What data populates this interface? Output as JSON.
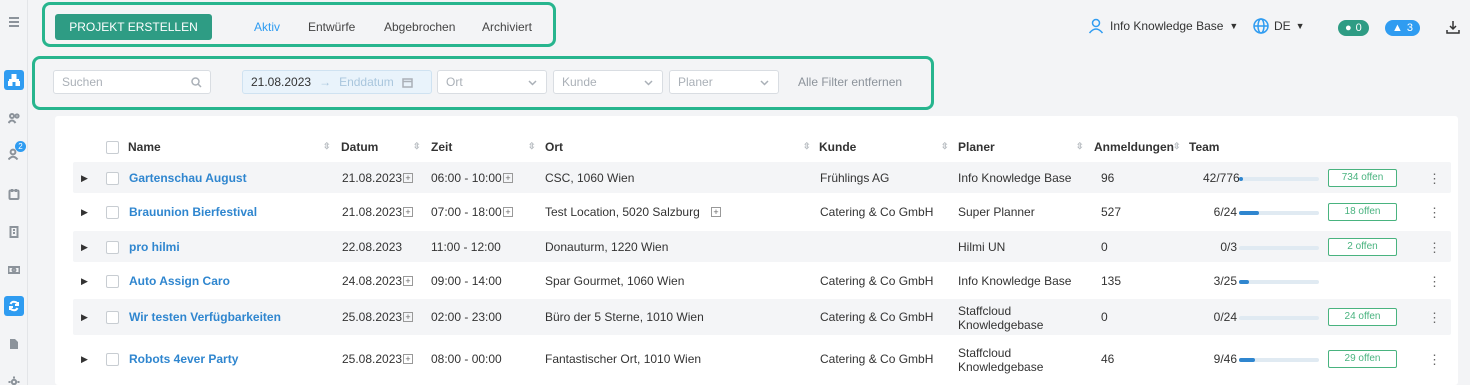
{
  "toolbar": {
    "create_label": "PROJEKT ERSTELLEN",
    "tabs": [
      {
        "label": "Aktiv"
      },
      {
        "label": "Entwürfe"
      },
      {
        "label": "Abgebrochen"
      },
      {
        "label": "Archiviert"
      }
    ],
    "user_label": "Info Knowledge Base",
    "lang_label": "DE",
    "chat_count": "0",
    "notification_count": "3"
  },
  "sidebar": {
    "users_badge": "2",
    "items": [
      {
        "icon": "menu-icon"
      },
      {
        "icon": "org-chart-icon"
      },
      {
        "icon": "group-icon"
      },
      {
        "icon": "user-add-icon"
      },
      {
        "icon": "calendar-icon"
      },
      {
        "icon": "building-icon"
      },
      {
        "icon": "money-icon"
      },
      {
        "icon": "refresh-icon"
      },
      {
        "icon": "document-icon"
      },
      {
        "icon": "gear-icon"
      }
    ]
  },
  "filters": {
    "search_placeholder": "Suchen",
    "start_date": "21.08.2023",
    "arrow": "→",
    "end_date_placeholder": "Enddatum",
    "location_placeholder": "Ort",
    "customer_placeholder": "Kunde",
    "planner_placeholder": "Planer",
    "clear_label": "Alle Filter entfernen"
  },
  "table": {
    "headers": {
      "name": "Name",
      "date": "Datum",
      "time": "Zeit",
      "location": "Ort",
      "customer": "Kunde",
      "planner": "Planer",
      "registrations": "Anmeldungen",
      "team": "Team"
    },
    "rows": [
      {
        "name": "Gartenschau August",
        "date": "21.08.2023",
        "time": "06:00 - 10:00",
        "location": "CSC, 1060 Wien",
        "customer": "Frühlings AG",
        "planner": "Info Knowledge Base",
        "registrations": "96",
        "team": "42/776",
        "fill": 0.054,
        "open": "734 offen"
      },
      {
        "name": "Brauunion Bierfestival",
        "date": "21.08.2023",
        "time": "07:00 - 18:00",
        "location": "Test Location, 5020 Salzburg",
        "customer": "Catering & Co GmbH",
        "planner": "Super Planner",
        "registrations": "527",
        "team": "6/24",
        "fill": 0.25,
        "open": "18 offen"
      },
      {
        "name": "pro hilmi",
        "date": "22.08.2023",
        "time": "11:00 - 12:00",
        "location": "Donauturm, 1220 Wien",
        "customer": "",
        "planner": "Hilmi UN",
        "registrations": "0",
        "team": "0/3",
        "fill": 0,
        "open": "2 offen"
      },
      {
        "name": "Auto Assign Caro",
        "date": "24.08.2023",
        "time": "09:00 - 14:00",
        "location": "Spar Gourmet, 1060 Wien",
        "customer": "Catering & Co GmbH",
        "planner": "Info Knowledge Base",
        "registrations": "135",
        "team": "3/25",
        "fill": 0.12,
        "open": ""
      },
      {
        "name": "Wir testen Verfügbarkeiten",
        "date": "25.08.2023",
        "time": "02:00 - 23:00",
        "location": "Büro der 5 Sterne, 1010 Wien",
        "customer": "Catering & Co GmbH",
        "planner": "Staffcloud Knowledgebase",
        "registrations": "0",
        "team": "0/24",
        "fill": 0,
        "open": "24 offen"
      },
      {
        "name": "Robots 4ever Party",
        "date": "25.08.2023",
        "time": "08:00 - 00:00",
        "location": "Fantastischer Ort, 1010 Wien",
        "customer": "Catering & Co GmbH",
        "planner": "Staffcloud Knowledgebase",
        "registrations": "46",
        "team": "9/46",
        "fill": 0.196,
        "open": "29 offen"
      }
    ]
  },
  "colors": {
    "accent": "#2f9cf1",
    "brand_green": "#2e9c84",
    "highlight_box": "#27b58e",
    "link": "#2f86cf"
  }
}
